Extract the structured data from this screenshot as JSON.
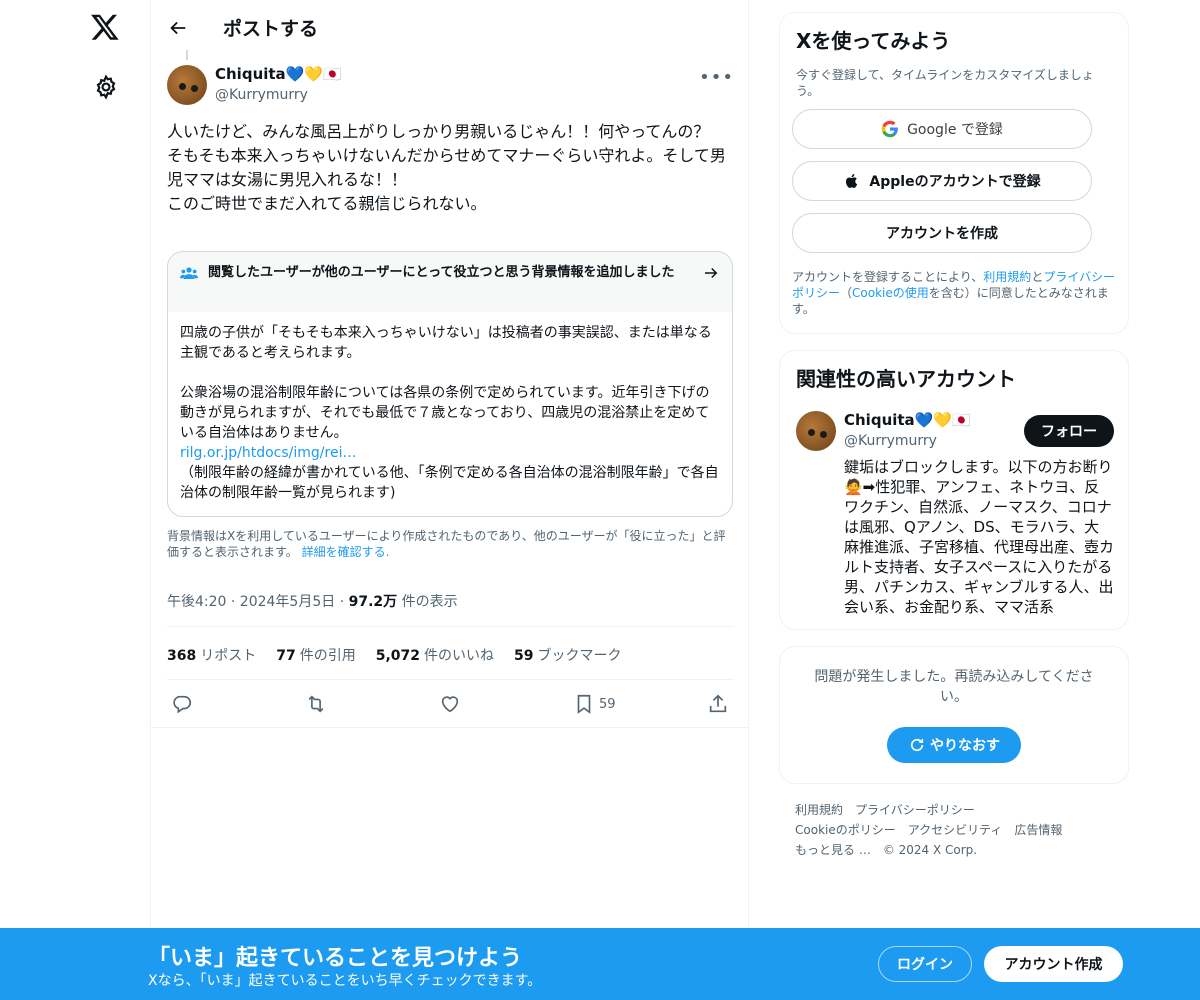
{
  "header": {
    "title": "ポストする"
  },
  "tweet": {
    "author_name": "Chiquita💙💛🇯🇵",
    "author_handle": "@Kurrymurry",
    "text_lines": [
      "人いたけど、みんな風呂上がりしっかり男親いるじゃん！！何やってんの？",
      "そもそも本来入っちゃいけないんだからせめてマナーぐらい守れよ。そして男児ママは女湯に男児入れるな！！",
      "このご時世でまだ入れてる親信じられない。"
    ],
    "note": {
      "heading": "閲覧したユーザーが他のユーザーにとって役立つと思う背景情報を追加しました",
      "para1": "四歳の子供が「そもそも本来入っちゃいけない」は投稿者の事実誤認、または単なる主観であると考えられます。",
      "para2": "公衆浴場の混浴制限年齢については各県の条例で定められています。近年引き下げの動きが見られますが、それでも最低で７歳となっており、四歳児の混浴禁止を定めている自治体はありません。",
      "link": "rilg.or.jp/htdocs/img/rei…",
      "para3": "（制限年齢の経緯が書かれている他、「条例で定める各自治体の混浴制限年齢」で各自治体の制限年齢一覧が見られます)"
    },
    "note_footer": "背景情報はXを利用しているユーザーにより作成されたものであり、他のユーザーが「役に立った」と評価すると表示されます。",
    "note_footer_link": "詳細を確認する.",
    "time": "午後4:20 · 2024年5月5日 · ",
    "views": "97.2万",
    "views_label": "件の表示",
    "stats": [
      {
        "count": "368",
        "label": "リポスト"
      },
      {
        "count": "77",
        "label": "件の引用"
      },
      {
        "count": "5,072",
        "label": "件のいいね"
      },
      {
        "count": "59",
        "label": "ブックマーク"
      }
    ],
    "bookmark_count": "59"
  },
  "sidebar": {
    "signup": {
      "title": "Xを使ってみよう",
      "subtitle": "今すぐ登録して、タイムラインをカスタマイズしましょう。",
      "google": "Google で登録",
      "apple": "Appleのアカウントで登録",
      "create": "アカウントを作成",
      "legal_1": "アカウントを登録することにより、",
      "legal_terms": "利用規約",
      "legal_2": "と",
      "legal_privacy": "プライバシーポリシー",
      "legal_3": "（",
      "legal_cookie": "Cookieの使用",
      "legal_4": "を含む）に同意したとみなされます。"
    },
    "related": {
      "title": "関連性の高いアカウント",
      "name": "Chiquita💙💛🇯🇵",
      "handle": "@Kurrymurry",
      "follow": "フォロー",
      "bio": "鍵垢はブロックします。以下の方お断り🙅➡性犯罪、アンフェ、ネトウヨ、反ワクチン、自然派、ノーマスク、コロナは風邪、Qアノン、DS、モラハラ、大麻推進派、子宮移植、代理母出産、壺カルト支持者、女子スペースに入りたがる男、パチンカス、ギャンブルする人、出会い系、お金配り系、ママ活系"
    },
    "error": {
      "message": "問題が発生しました。再読み込みしてください。",
      "retry": "やりなおす"
    },
    "footer": {
      "terms": "利用規約",
      "privacy": "プライバシーポリシー",
      "cookie": "Cookieのポリシー",
      "accessibility": "アクセシビリティ",
      "ads": "広告情報",
      "more": "もっと見る …",
      "copyright": "© 2024 X Corp."
    }
  },
  "bottom_bar": {
    "headline": "「いま」起きていることを見つけよう",
    "sub": "Xなら、「いま」起きていることをいち早くチェックできます。",
    "login": "ログイン",
    "signup": "アカウント作成"
  },
  "colors": {
    "accent": "#1d9bf0",
    "text": "#0f1419",
    "muted": "#536471",
    "border": "#eff3f4"
  }
}
